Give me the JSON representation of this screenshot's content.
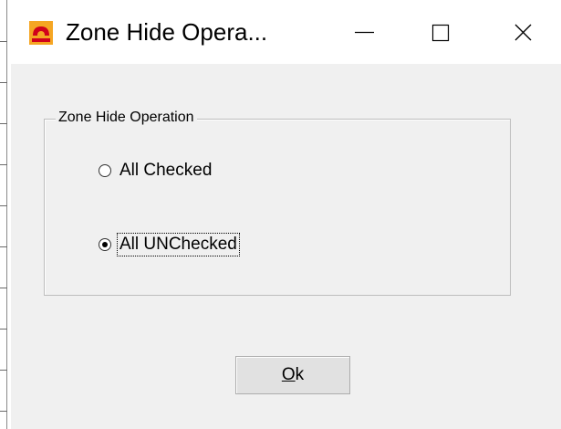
{
  "window": {
    "title": "Zone Hide Opera...",
    "icon": "app-logo-icon",
    "controls": {
      "minimize_icon": "minimize-icon",
      "maximize_icon": "maximize-icon",
      "close_icon": "close-icon"
    }
  },
  "group": {
    "label": "Zone Hide Operation",
    "options": [
      {
        "label": "All Checked",
        "selected": false
      },
      {
        "label": "All UNChecked",
        "selected": true
      }
    ]
  },
  "ok_button": {
    "mnemonic": "O",
    "rest": "k"
  },
  "colors": {
    "window_bg": "#f0f0f0",
    "titlebar_bg": "#ffffff",
    "button_bg": "#e1e1e1",
    "icon_orange": "#f5a623",
    "icon_red": "#d0021b"
  }
}
